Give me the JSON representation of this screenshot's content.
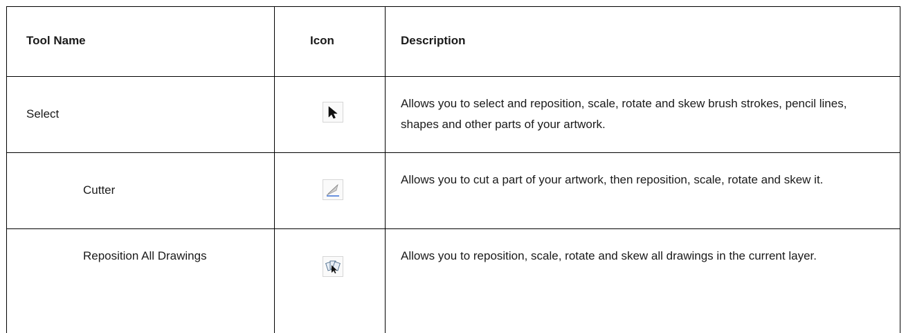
{
  "columns": {
    "tool_name": "Tool Name",
    "icon": "Icon",
    "description": "Description"
  },
  "rows": [
    {
      "name": "Select",
      "icon": "select-arrow-icon",
      "description": "Allows you to select and reposition, scale, rotate and skew brush strokes, pencil lines, shapes and other parts of your artwork."
    },
    {
      "name": "Cutter",
      "icon": "cutter-icon",
      "description": "Allows you to cut a part of your artwork, then reposition, scale, rotate and skew it."
    },
    {
      "name": "Reposition All Drawings",
      "icon": "reposition-all-drawings-icon",
      "description": "Allows you to reposition, scale, rotate and skew all drawings in the current layer."
    }
  ]
}
